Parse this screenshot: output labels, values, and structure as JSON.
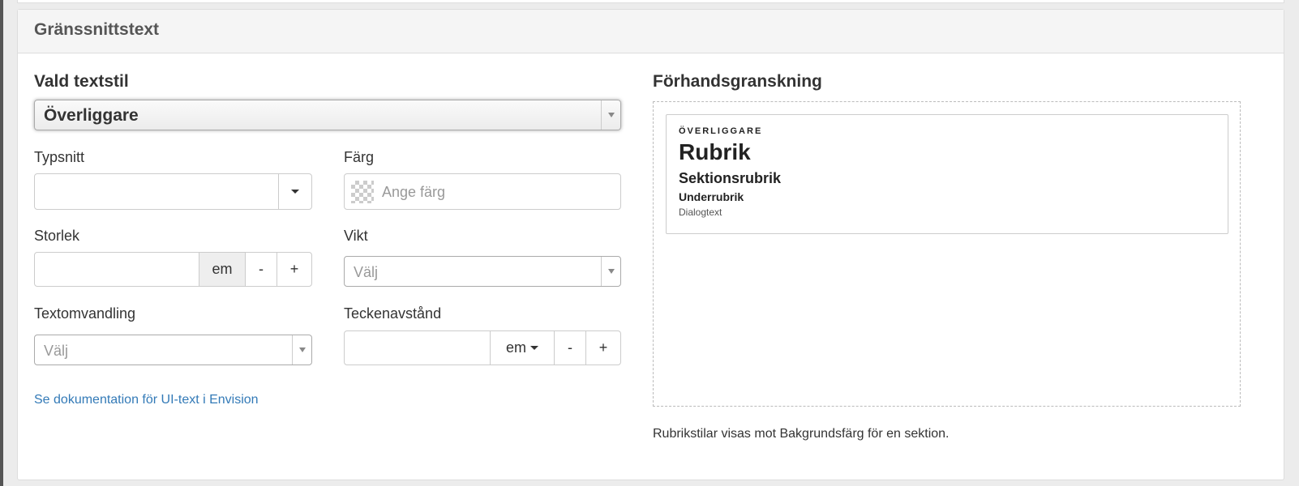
{
  "panel": {
    "title": "Gränssnittstext"
  },
  "editor": {
    "heading": "Vald textstil",
    "selected_style": "Överliggare",
    "font": {
      "label": "Typsnitt",
      "value": ""
    },
    "color": {
      "label": "Färg",
      "placeholder": "Ange färg"
    },
    "size": {
      "label": "Storlek",
      "value": "",
      "unit": "em",
      "minus": "-",
      "plus": "+"
    },
    "weight": {
      "label": "Vikt",
      "placeholder": "Välj"
    },
    "transform": {
      "label": "Textomvandling",
      "placeholder": "Välj"
    },
    "spacing": {
      "label": "Teckenavstånd",
      "value": "",
      "unit": "em",
      "minus": "-",
      "plus": "+"
    },
    "doc_link": "Se dokumentation för UI-text i Envision"
  },
  "preview": {
    "heading": "Förhandsgranskning",
    "overline": "ÖVERLIGGARE",
    "title": "Rubrik",
    "section_title": "Sektionsrubrik",
    "subtitle": "Underrubrik",
    "dialog_text": "Dialogtext",
    "note": "Rubrikstilar visas mot Bakgrundsfärg för en sektion."
  },
  "colors": {
    "link": "#337ab7",
    "panel_header_bg": "#f5f5f5",
    "border": "#cccccc"
  },
  "icons": [
    "chevron-down-icon",
    "caret-down-icon",
    "transparent-swatch-icon"
  ]
}
